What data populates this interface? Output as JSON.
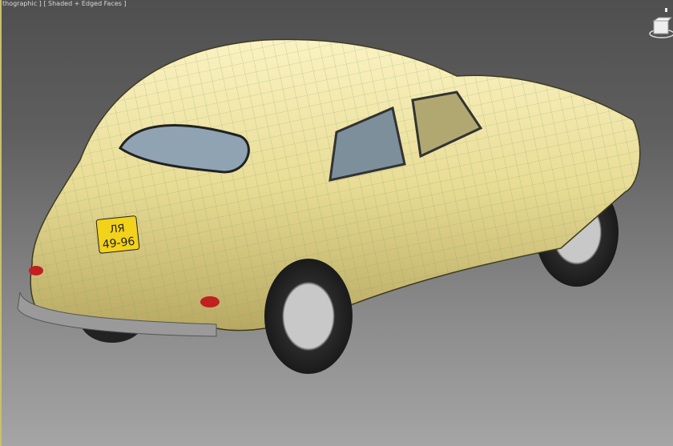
{
  "viewport": {
    "label": "[ + ] [ Orthographic ] [ Shaded + Edged Faces ]",
    "label_visible": "thographic ] [ Shaded + Edged Faces ]",
    "background_top": "#4f4f4f",
    "background_bottom": "#a5a5a5",
    "active_border_color": "#c9c06a"
  },
  "model": {
    "body_color": "#efe3a0",
    "wire_color": "#6fa86a",
    "license_plate": {
      "line1": "ЛЯ",
      "line2": "49-96",
      "color": "#f2d21a"
    }
  },
  "viewcube": {
    "icon": "viewcube-icon"
  }
}
